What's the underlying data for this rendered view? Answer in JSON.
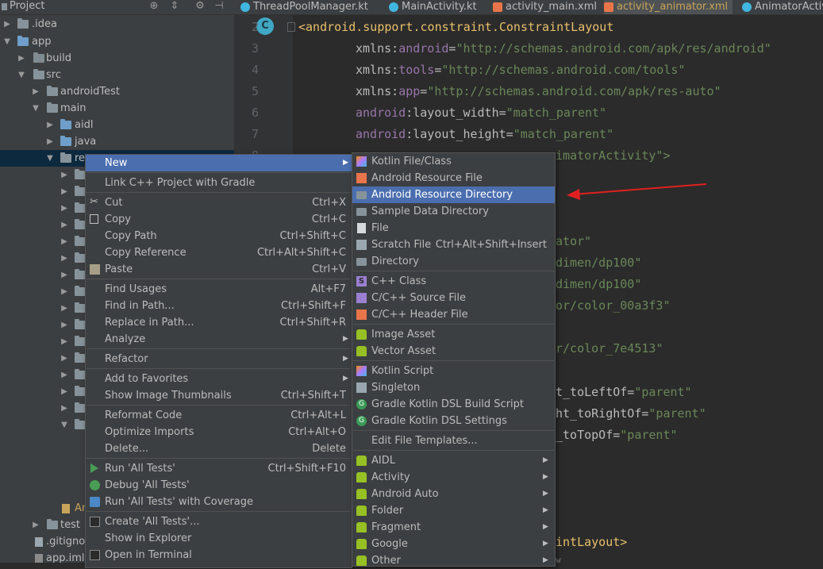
{
  "project_panel": {
    "title": "Project",
    "tree": [
      {
        "label": ".idea"
      },
      {
        "label": "app"
      },
      {
        "label": "build"
      },
      {
        "label": "src"
      },
      {
        "label": "androidTest"
      },
      {
        "label": "main"
      },
      {
        "label": "aidl"
      },
      {
        "label": "java"
      },
      {
        "label": "re"
      },
      {
        "label": "An"
      },
      {
        "label": "test"
      },
      {
        "label": ".gitignor"
      },
      {
        "label": "app.iml"
      }
    ]
  },
  "tabs": [
    {
      "label": "ThreadPoolManager.kt"
    },
    {
      "label": "MainActivity.kt"
    },
    {
      "label": "activity_main.xml"
    },
    {
      "label": "activity_animator.xml"
    },
    {
      "label": "AnimatorActivit"
    }
  ],
  "editor": {
    "badge": "C",
    "line_numbers": [
      "2",
      "3",
      "4",
      "5",
      "6",
      "7",
      "8"
    ],
    "lines": [
      {
        "p1": "<",
        "p2": "android.support.constraint.ConstraintLayout",
        "p3": "",
        "p4": ""
      },
      {
        "p1": "android",
        "p2": ":",
        "p3": "xmlns:",
        "p4": "\"http://schemas.android.com/apk/res/android\""
      },
      {
        "p1": "tools",
        "p2": "=",
        "p3": "xmlns:",
        "p4": "\"http://schemas.android.com/tools\""
      },
      {
        "p1": "app",
        "p2": "=",
        "p3": "xmlns:",
        "p4": "\"http://schemas.android.com/apk/res-auto\""
      },
      {
        "p1": "android",
        "p2": ":layout_width=",
        "p3": "",
        "p4": "\"match_parent\""
      },
      {
        "p1": "android",
        "p2": ":layout_height=",
        "p3": "",
        "p4": "\"match_parent\""
      },
      {
        "p1": "",
        "p2": "",
        "p3": "",
        "p4": "imatorActivity\">"
      }
    ],
    "fragments": [
      "ator\"",
      "dimen/dp100\"",
      "dimen/dp100\"",
      "or/color_00a3f3\"",
      "r/color_7e4513\"",
      "t_toLeftOf=",
      "\"parent\"",
      "ht_toRightOf=",
      "\"parent\"",
      "_toTopOf=",
      "\"parent\"",
      "intLayout>",
      "w"
    ]
  },
  "context_menu": {
    "items": [
      {
        "label": "New",
        "shortcut": ""
      },
      {
        "label": "Link C++ Project with Gradle",
        "shortcut": ""
      },
      {
        "label": "Cut",
        "shortcut": "Ctrl+X"
      },
      {
        "label": "Copy",
        "shortcut": "Ctrl+C"
      },
      {
        "label": "Copy Path",
        "shortcut": "Ctrl+Shift+C"
      },
      {
        "label": "Copy Reference",
        "shortcut": "Ctrl+Alt+Shift+C"
      },
      {
        "label": "Paste",
        "shortcut": "Ctrl+V"
      },
      {
        "label": "Find Usages",
        "shortcut": "Alt+F7"
      },
      {
        "label": "Find in Path...",
        "shortcut": "Ctrl+Shift+F"
      },
      {
        "label": "Replace in Path...",
        "shortcut": "Ctrl+Shift+R"
      },
      {
        "label": "Analyze",
        "shortcut": ""
      },
      {
        "label": "Refactor",
        "shortcut": ""
      },
      {
        "label": "Add to Favorites",
        "shortcut": ""
      },
      {
        "label": "Show Image Thumbnails",
        "shortcut": "Ctrl+Shift+T"
      },
      {
        "label": "Reformat Code",
        "shortcut": "Ctrl+Alt+L"
      },
      {
        "label": "Optimize Imports",
        "shortcut": "Ctrl+Alt+O"
      },
      {
        "label": "Delete...",
        "shortcut": "Delete"
      },
      {
        "label": "Run 'All Tests'",
        "shortcut": "Ctrl+Shift+F10"
      },
      {
        "label": "Debug 'All Tests'",
        "shortcut": ""
      },
      {
        "label": "Run 'All Tests' with Coverage",
        "shortcut": ""
      },
      {
        "label": "Create 'All Tests'...",
        "shortcut": ""
      },
      {
        "label": "Show in Explorer",
        "shortcut": ""
      },
      {
        "label": "Open in Terminal",
        "shortcut": ""
      }
    ]
  },
  "new_submenu": {
    "items": [
      {
        "label": "Kotlin File/Class",
        "shortcut": ""
      },
      {
        "label": "Android Resource File",
        "shortcut": ""
      },
      {
        "label": "Android Resource Directory",
        "shortcut": ""
      },
      {
        "label": "Sample Data Directory",
        "shortcut": ""
      },
      {
        "label": "File",
        "shortcut": ""
      },
      {
        "label": "Scratch File",
        "shortcut": "Ctrl+Alt+Shift+Insert"
      },
      {
        "label": "Directory",
        "shortcut": ""
      },
      {
        "label": "C++ Class",
        "shortcut": ""
      },
      {
        "label": "C/C++ Source File",
        "shortcut": ""
      },
      {
        "label": "C/C++ Header File",
        "shortcut": ""
      },
      {
        "label": "Image Asset",
        "shortcut": ""
      },
      {
        "label": "Vector Asset",
        "shortcut": ""
      },
      {
        "label": "Kotlin Script",
        "shortcut": ""
      },
      {
        "label": "Singleton",
        "shortcut": ""
      },
      {
        "label": "Gradle Kotlin DSL Build Script",
        "shortcut": ""
      },
      {
        "label": "Gradle Kotlin DSL Settings",
        "shortcut": ""
      },
      {
        "label": "Edit File Templates...",
        "shortcut": ""
      },
      {
        "label": "AIDL",
        "shortcut": ""
      },
      {
        "label": "Activity",
        "shortcut": ""
      },
      {
        "label": "Android Auto",
        "shortcut": ""
      },
      {
        "label": "Folder",
        "shortcut": ""
      },
      {
        "label": "Fragment",
        "shortcut": ""
      },
      {
        "label": "Google",
        "shortcut": ""
      },
      {
        "label": "Other",
        "shortcut": ""
      }
    ]
  },
  "colors": {
    "highlight": "#4b6eaf",
    "annotation_arrow": "#e02020",
    "menu_bg": "#3c3f41",
    "editor_bg": "#2b2b2b"
  }
}
